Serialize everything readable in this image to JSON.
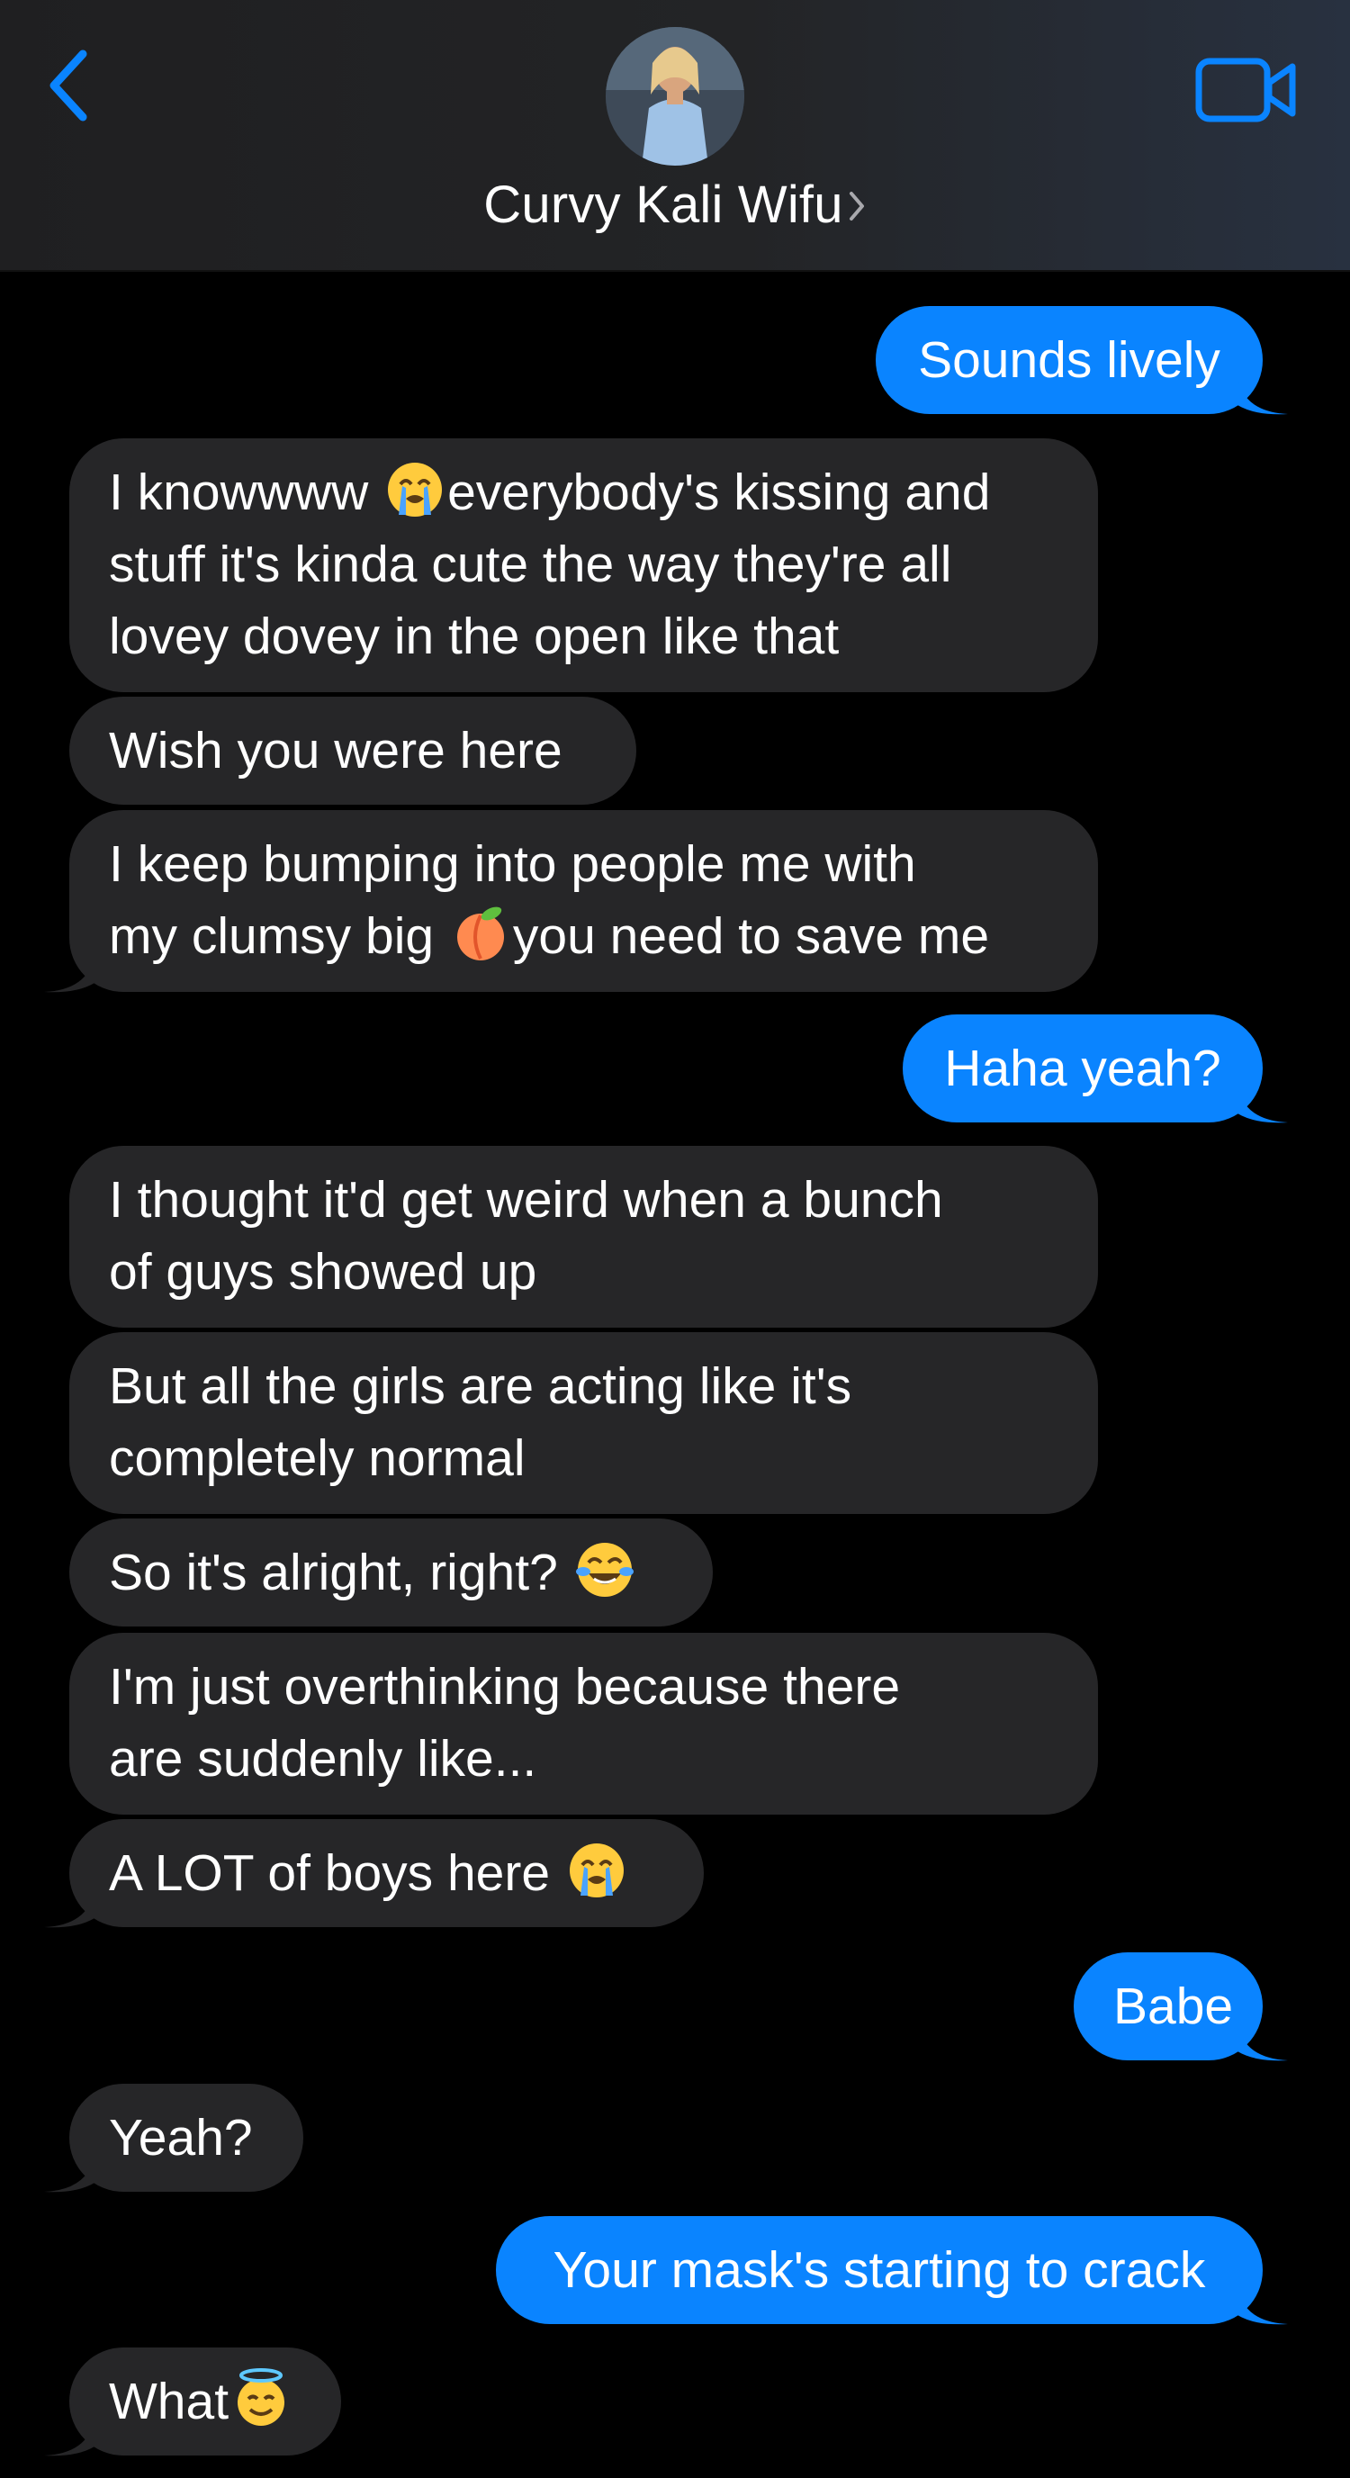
{
  "header": {
    "contact_name": "Curvy Kali Wifu",
    "icons": {
      "back": "chevron-left-icon",
      "video": "video-camera-icon",
      "name_chevron": "chevron-right-icon"
    }
  },
  "colors": {
    "accent": "#0a84ff",
    "sent_bubble": "#0a84ff",
    "received_bubble": "#262628",
    "background": "#000000",
    "header_bg": "#232426"
  },
  "messages": [
    {
      "direction": "sent",
      "text": "Sounds lively"
    },
    {
      "direction": "received",
      "line1_a": "I knowwww ",
      "emoji": "loudly-crying-face",
      "line1_b": "everybody's kissing and",
      "line2": "stuff it's kinda cute the way they're all",
      "line3": "lovey dovey in the open like that"
    },
    {
      "direction": "received",
      "text": "Wish you were here"
    },
    {
      "direction": "received",
      "line1": "I keep bumping into people me with",
      "line2_a": "my clumsy big ",
      "emoji": "peach",
      "line2_b": "you need to save me"
    },
    {
      "direction": "sent",
      "text": "Haha yeah?"
    },
    {
      "direction": "received",
      "line1": "I thought it'd get weird when a bunch",
      "line2": "of guys showed up"
    },
    {
      "direction": "received",
      "line1": "But all the girls are acting like it's",
      "line2": "completely normal"
    },
    {
      "direction": "received",
      "text": "So it's alright, right? ",
      "emoji": "face-with-tears-of-joy"
    },
    {
      "direction": "received",
      "line1": "I'm just overthinking because there",
      "line2": "are suddenly like..."
    },
    {
      "direction": "received",
      "text": "A LOT of boys here ",
      "emoji": "loudly-crying-face"
    },
    {
      "direction": "sent",
      "text": "Babe"
    },
    {
      "direction": "received",
      "text": "Yeah?"
    },
    {
      "direction": "sent",
      "text": "Your mask's starting to crack"
    },
    {
      "direction": "received",
      "text": "What",
      "emoji": "smiling-face-with-halo"
    }
  ]
}
